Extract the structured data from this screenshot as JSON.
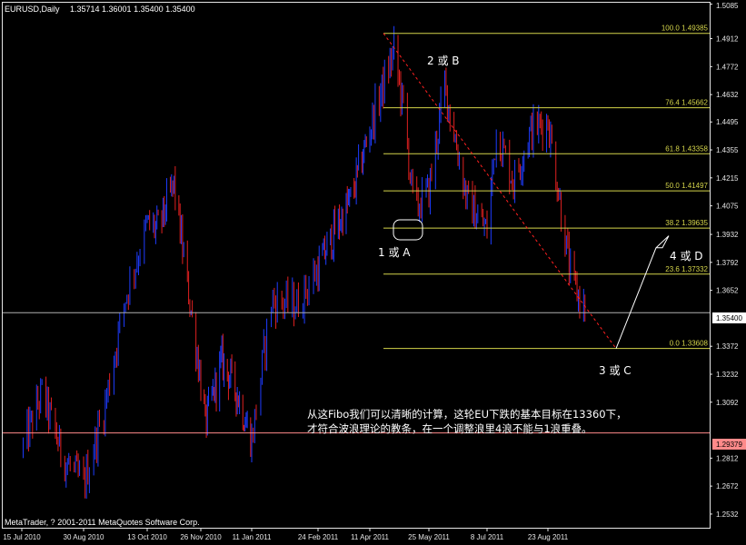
{
  "header": {
    "symbol": "EURUSD,Daily",
    "ohlc": "1.35714 1.36001 1.35400 1.35400"
  },
  "footer": {
    "copyright": "MetaTrader, ? 2001-2011 MetaQuotes Software Corp."
  },
  "colors": {
    "background": "#000000",
    "bull": "#1e3cff",
    "bear": "#e02020",
    "fib": "#d4d44a",
    "axis": "#e6e6e6",
    "trend": "#ff2020"
  },
  "chart_data": {
    "type": "candlestick",
    "title": "EURUSD,Daily",
    "ylim": [
      1.2468,
      1.5085
    ],
    "y_ticks": [
      1.5085,
      1.4912,
      1.4772,
      1.4632,
      1.4495,
      1.4355,
      1.4215,
      1.4075,
      1.3932,
      1.3792,
      1.3652,
      1.3372,
      1.3232,
      1.3092,
      1.2812,
      1.2672,
      1.2532
    ],
    "x_labels": [
      "15 Jul 2010",
      "30 Aug 2010",
      "13 Oct 2010",
      "26 Nov 2010",
      "11 Jan 2011",
      "24 Feb 2011",
      "11 Apr 2011",
      "25 May 2011",
      "8 Jul 2011",
      "23 Aug 2011"
    ],
    "close_path": [
      [
        "15 Jul 2010",
        1.285
      ],
      [
        "30 Jul 2010",
        1.314
      ],
      [
        "15 Aug 2010",
        1.281
      ],
      [
        "30 Aug 2010",
        1.268
      ],
      [
        "13 Sep 2010",
        1.305
      ],
      [
        "28 Sep 2010",
        1.362
      ],
      [
        "13 Oct 2010",
        1.398
      ],
      [
        "22 Oct 2010",
        1.396
      ],
      [
        "4 Nov 2010",
        1.418
      ],
      [
        "15 Nov 2010",
        1.368
      ],
      [
        "26 Nov 2010",
        1.32
      ],
      [
        "30 Nov 2010",
        1.298
      ],
      [
        "15 Dec 2010",
        1.33
      ],
      [
        "28 Dec 2010",
        1.315
      ],
      [
        "11 Jan 2011",
        1.29
      ],
      [
        "24 Jan 2011",
        1.36
      ],
      [
        "10 Feb 2011",
        1.358
      ],
      [
        "24 Feb 2011",
        1.376
      ],
      [
        "11 Mar 2011",
        1.395
      ],
      [
        "26 Mar 2011",
        1.412
      ],
      [
        "11 Apr 2011",
        1.446
      ],
      [
        "29 Apr 2011",
        1.485
      ],
      [
        "6 May 2011",
        1.456
      ],
      [
        "14 May 2011",
        1.405
      ],
      [
        "25 May 2011",
        1.415
      ],
      [
        "6 Jun 2011",
        1.468
      ],
      [
        "23 Jun 2011",
        1.41
      ],
      [
        "8 Jul 2011",
        1.395
      ],
      [
        "15 Jul 2011",
        1.445
      ],
      [
        "28 Jul 2011",
        1.42
      ],
      [
        "10 Aug 2011",
        1.445
      ],
      [
        "23 Aug 2011",
        1.45
      ],
      [
        "1 Sep 2011",
        1.41
      ],
      [
        "9 Sep 2011",
        1.372
      ],
      [
        "20 Sep 2011",
        1.355
      ]
    ],
    "current_price": {
      "label": "1.35400",
      "value": 1.354
    },
    "support_line": {
      "label": "1.29379",
      "value": 1.2938
    },
    "fib_levels": [
      {
        "ratio": "100.0",
        "price": "1.49385"
      },
      {
        "ratio": "76.4",
        "price": "1.45662"
      },
      {
        "ratio": "61.8",
        "price": "1.43358"
      },
      {
        "ratio": "50.0",
        "price": "1.41497"
      },
      {
        "ratio": "38.2",
        "price": "1.39635"
      },
      {
        "ratio": "23.6",
        "price": "1.37332"
      },
      {
        "ratio": "0.0",
        "price": "1.33608"
      }
    ],
    "wave_labels": [
      {
        "text": "2 或 B"
      },
      {
        "text": "1 或 A"
      },
      {
        "text": "4 或 D"
      },
      {
        "text": "3 或 C"
      }
    ],
    "annotation_lines": [
      "从这Fibo我们可以清晰的计算，这轮EU下跌的基本目标在13360下，",
      "才符合波浪理论的教条，在一个调整浪里4浪不能与1浪重叠。"
    ]
  }
}
